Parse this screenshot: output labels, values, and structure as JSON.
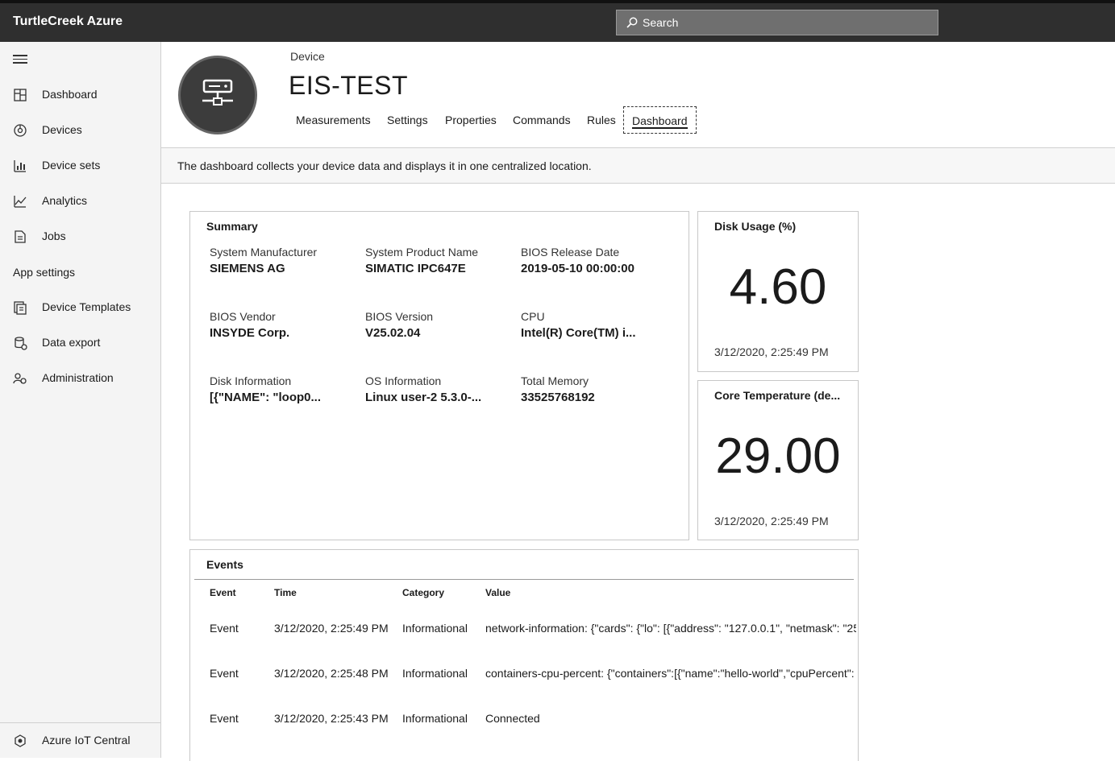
{
  "app": {
    "title": "TurtleCreek Azure"
  },
  "search": {
    "label": "Search"
  },
  "sidebar": {
    "items": [
      {
        "label": "Dashboard",
        "icon": "dashboard-icon"
      },
      {
        "label": "Devices",
        "icon": "devices-icon"
      },
      {
        "label": "Device sets",
        "icon": "device-sets-icon"
      },
      {
        "label": "Analytics",
        "icon": "analytics-icon"
      },
      {
        "label": "Jobs",
        "icon": "jobs-icon"
      }
    ],
    "section_label": "App settings",
    "settings_items": [
      {
        "label": "Device Templates",
        "icon": "device-templates-icon"
      },
      {
        "label": "Data export",
        "icon": "data-export-icon"
      },
      {
        "label": "Administration",
        "icon": "administration-icon"
      }
    ],
    "footer_label": "Azure IoT Central"
  },
  "device": {
    "label": "Device",
    "name": "EIS-TEST",
    "tabs": [
      "Measurements",
      "Settings",
      "Properties",
      "Commands",
      "Rules",
      "Dashboard"
    ],
    "active_tab": "Dashboard"
  },
  "info_text": "The dashboard collects your device data and displays it in one centralized location.",
  "summary": {
    "title": "Summary",
    "fields": [
      {
        "key": "System Manufacturer",
        "value": "SIEMENS AG"
      },
      {
        "key": "System Product Name",
        "value": "SIMATIC IPC647E"
      },
      {
        "key": "BIOS Release Date",
        "value": "2019-05-10 00:00:00"
      },
      {
        "key": "BIOS Vendor",
        "value": "INSYDE Corp."
      },
      {
        "key": "BIOS Version",
        "value": "V25.02.04"
      },
      {
        "key": "CPU",
        "value": "Intel(R) Core(TM) i..."
      },
      {
        "key": "Disk Information",
        "value": "[{\"NAME\": \"loop0..."
      },
      {
        "key": "OS Information",
        "value": "Linux user-2 5.3.0-..."
      },
      {
        "key": "Total Memory",
        "value": "33525768192"
      }
    ]
  },
  "kpis": [
    {
      "title": "Disk Usage (%)",
      "value": "4.60",
      "timestamp": "3/12/2020, 2:25:49 PM"
    },
    {
      "title": "Core Temperature (de...",
      "value": "29.00",
      "timestamp": "3/12/2020, 2:25:49 PM"
    }
  ],
  "events": {
    "title": "Events",
    "columns": [
      "Event",
      "Time",
      "Category",
      "Value"
    ],
    "rows": [
      [
        "Event",
        "3/12/2020, 2:25:49 PM",
        "Informational",
        "network-information: {\"cards\": {\"lo\": [{\"address\": \"127.0.0.1\", \"netmask\": \"25"
      ],
      [
        "Event",
        "3/12/2020, 2:25:48 PM",
        "Informational",
        "containers-cpu-percent: {\"containers\":[{\"name\":\"hello-world\",\"cpuPercent\":"
      ],
      [
        "Event",
        "3/12/2020, 2:25:43 PM",
        "Informational",
        "Connected"
      ]
    ]
  },
  "colors": {
    "topbar": "#2f2f2f",
    "sidebar": "#f4f4f4",
    "avatar": "#3c3c3c"
  }
}
